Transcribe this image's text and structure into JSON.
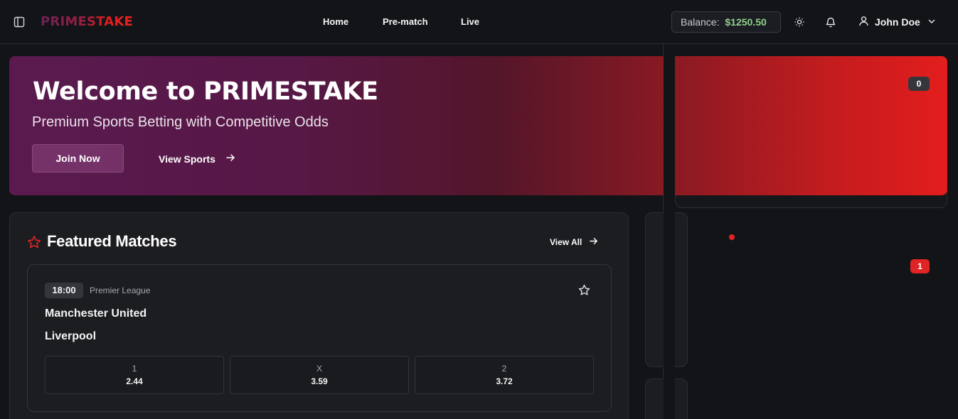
{
  "header": {
    "brand": "PRIMESTAKE",
    "nav": [
      {
        "label": "Home"
      },
      {
        "label": "Pre-match"
      },
      {
        "label": "Live"
      }
    ],
    "balance_label": "Balance:",
    "balance_value": "$1250.50",
    "user_name": "John Doe"
  },
  "hero": {
    "title": "Welcome to PRIMESTAKE",
    "subtitle": "Premium Sports Betting with Competitive Odds",
    "join_label": "Join Now",
    "view_sports_label": "View Sports"
  },
  "right_panel": {
    "badge_top": "0",
    "badge_bottom": "1"
  },
  "featured": {
    "title": "Featured Matches",
    "view_all_label": "View All",
    "matches": [
      {
        "time": "18:00",
        "league": "Premier League",
        "home": "Manchester United",
        "away": "Liverpool",
        "odds": [
          {
            "label": "1",
            "value": "2.44"
          },
          {
            "label": "X",
            "value": "3.59"
          },
          {
            "label": "2",
            "value": "3.72"
          }
        ]
      }
    ]
  },
  "colors": {
    "accent_red": "#e02424",
    "balance_green": "#8fd18a",
    "background": "#131417"
  }
}
